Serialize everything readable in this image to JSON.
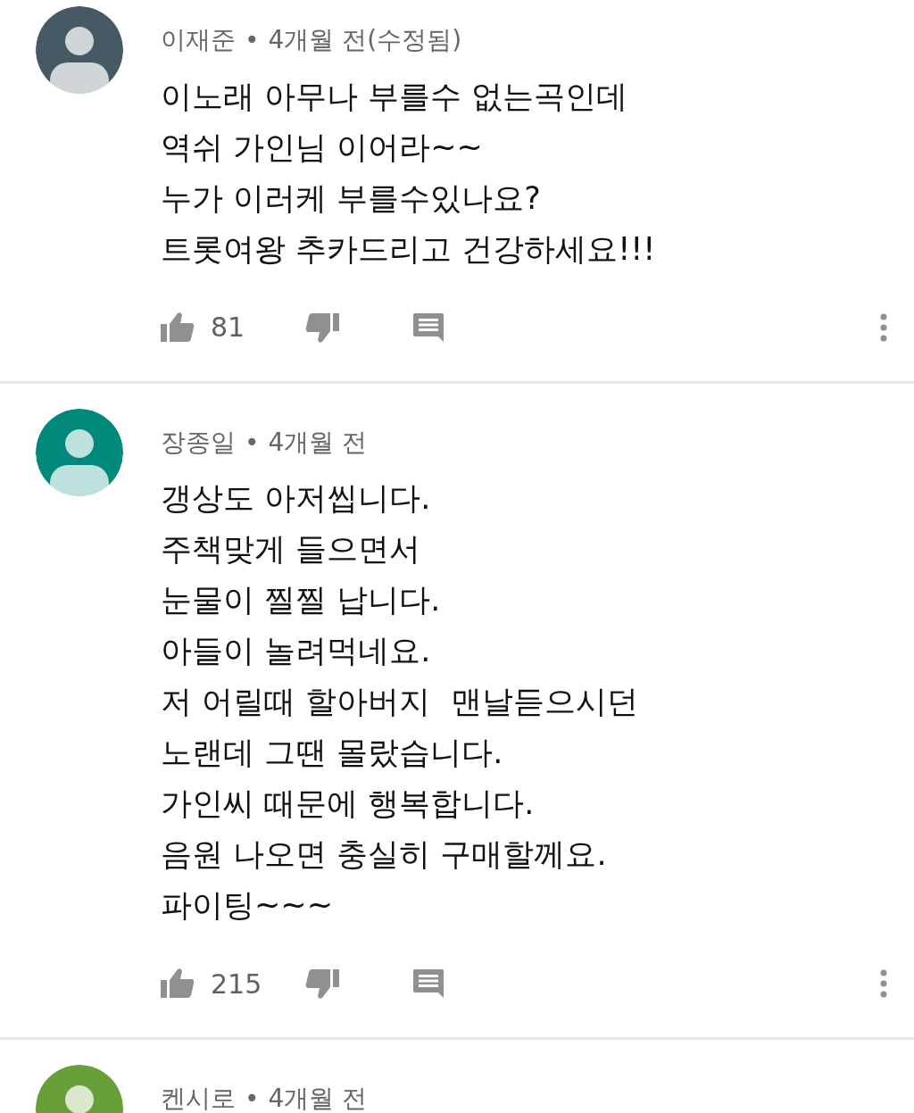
{
  "comments": [
    {
      "author": "이재준",
      "separator": "•",
      "time": "4개월 전(수정됨)",
      "color": "#455a64",
      "text": "이노래 아무나 부를수 없는곡인데\n역쉬 가인님 이어라~~\n누가 이러케 부를수있나요?\n트롯여왕 추카드리고 건강하세요!!!",
      "likes": "81"
    },
    {
      "author": "장종일",
      "separator": "•",
      "time": "4개월 전",
      "color": "#00897b",
      "text": "갱상도 아저씹니다.\n주책맞게 들으면서\n눈물이 찔찔 납니다.\n아들이 놀려먹네요.\n저 어릴때 할아버지  맨날듣으시던\n노랜데 그땐 몰랐습니다.\n가인씨 때문에 행복합니다.\n음원 나오면 충실히 구매할께요.\n파이팅~~~",
      "likes": "215"
    },
    {
      "author": "켄시로",
      "separator": "•",
      "time": "4개월 전",
      "color": "#689f38"
    }
  ]
}
